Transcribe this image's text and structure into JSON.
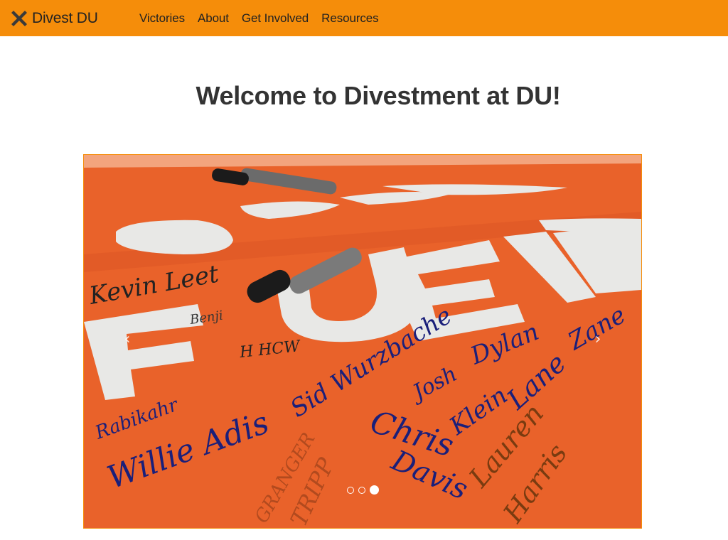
{
  "navbar": {
    "brand": {
      "icon": "x-mark-icon",
      "label": "Divest DU"
    },
    "links": [
      {
        "label": "Victories"
      },
      {
        "label": "About"
      },
      {
        "label": "Get Involved"
      },
      {
        "label": "Resources"
      }
    ],
    "background_color": "#f58d0a"
  },
  "main": {
    "title": "Welcome to Divestment at DU!"
  },
  "carousel": {
    "prev_icon": "chevron-left-icon",
    "next_icon": "chevron-right-icon",
    "prev_glyph": "‹",
    "next_glyph": "›",
    "slide_count": 3,
    "active_slide": 3,
    "slide_signatures": [
      "Chris Davis",
      "Josh Klein",
      "Dylan Lane",
      "Lauren Harris",
      "Zane",
      "Willie Adis",
      "Sid Wurzbache",
      "GRANGER",
      "TRIPP",
      "Benji"
    ],
    "slide_colors": {
      "banner": "#e9622a",
      "paint": "#e8e8e6",
      "ink": "#1a1f7a"
    }
  }
}
